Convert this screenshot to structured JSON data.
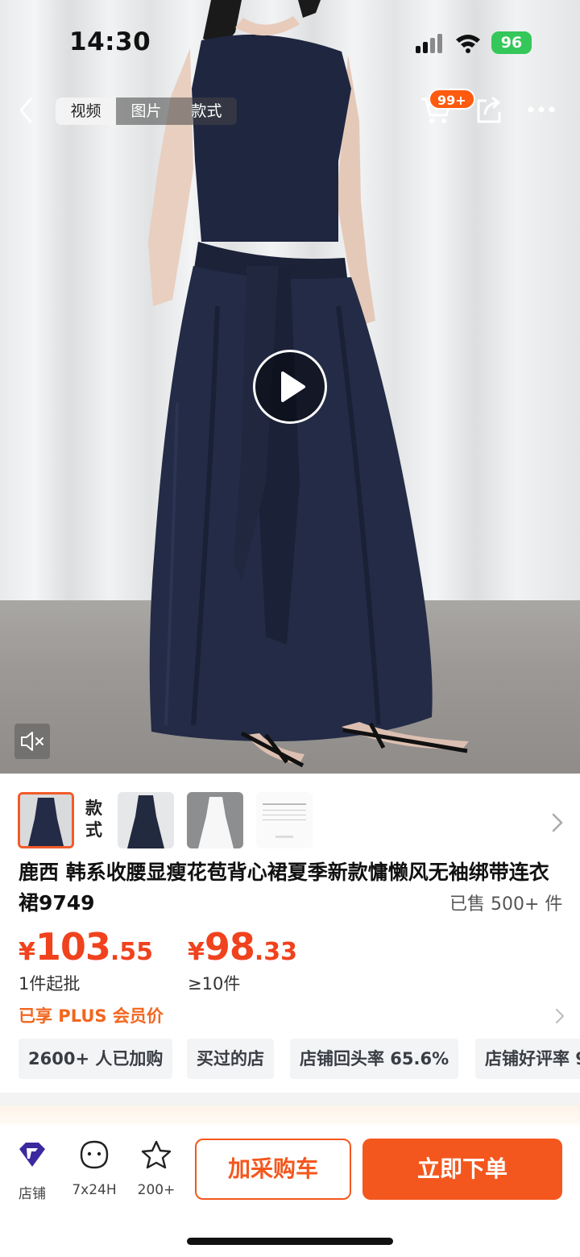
{
  "status_bar": {
    "time": "14:30",
    "battery": "96"
  },
  "nav": {
    "tabs": [
      {
        "label": "视频",
        "active": true
      },
      {
        "label": "图片",
        "active": false
      },
      {
        "label": "款式",
        "active": false
      }
    ],
    "cart_badge": "99+",
    "icons": {
      "back": "chevron-left-icon",
      "cart": "cart-icon",
      "share": "share-icon",
      "more": "more-icon"
    }
  },
  "media": {
    "play_icon": "play-icon",
    "mute_icon": "speaker-muted-icon"
  },
  "style_strip": {
    "label": "款式"
  },
  "product": {
    "title": "鹿西 韩系收腰显瘦花苞背心裙夏季新款慵懒风无袖绑带连衣裙9749",
    "sold": "已售 500+ 件",
    "prices": [
      {
        "currency": "¥",
        "integer": "103",
        "decimal": ".55",
        "condition": "1件起批"
      },
      {
        "currency": "¥",
        "integer": "98",
        "decimal": ".33",
        "condition": "≥10件"
      }
    ],
    "plus": "已享 PLUS 会员价",
    "tags": [
      {
        "num": "2600+",
        "text": " 人已加购"
      },
      {
        "num": "",
        "text": "买过的店"
      },
      {
        "num": "",
        "text": "店铺回头率 65.6%"
      },
      {
        "num": "",
        "text": "店铺好评率 9"
      }
    ]
  },
  "bottom_bar": {
    "items": [
      {
        "label": "店铺",
        "icon": "shop-logo-icon"
      },
      {
        "label": "7x24H",
        "icon": "chat-face-icon"
      },
      {
        "label": "200+",
        "icon": "star-icon"
      }
    ],
    "add_cart": "加采购车",
    "buy_now": "立即下单"
  },
  "colors": {
    "accent": "#f4571e",
    "price": "#f0421d",
    "plus": "#f2661f",
    "battery": "#34c759"
  }
}
